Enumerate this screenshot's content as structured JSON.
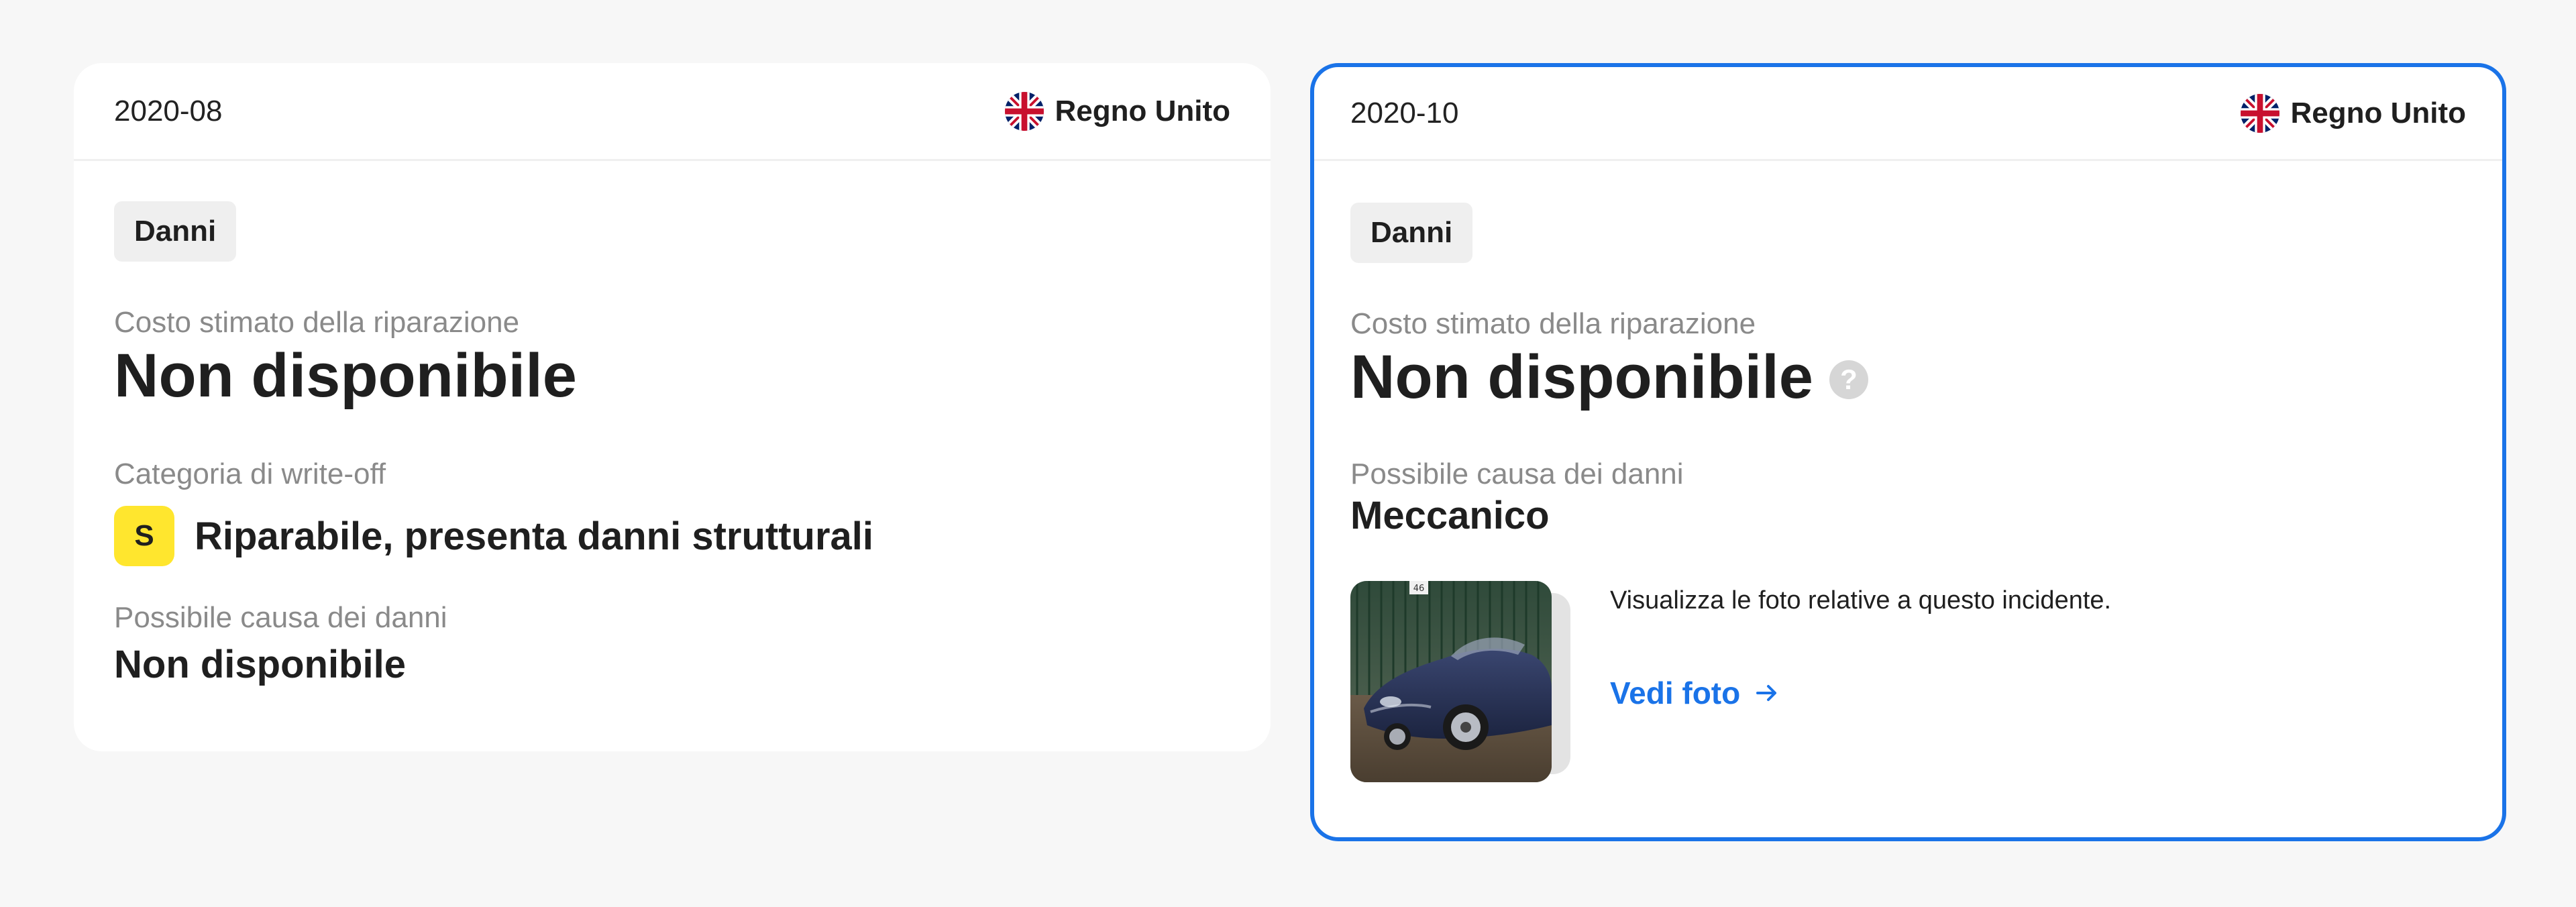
{
  "cards": [
    {
      "date": "2020-08",
      "country": "Regno Unito",
      "tag": "Danni",
      "cost_label": "Costo stimato della riparazione",
      "cost_value": "Non disponibile",
      "writeoff_label": "Categoria di write-off",
      "writeoff_badge": "S",
      "writeoff_text": "Riparabile, presenta danni strutturali",
      "cause_label": "Possibile causa dei danni",
      "cause_value": "Non disponibile"
    },
    {
      "date": "2020-10",
      "country": "Regno Unito",
      "tag": "Danni",
      "cost_label": "Costo stimato della riparazione",
      "cost_value": "Non disponibile",
      "help_icon": "?",
      "cause_label": "Possibile causa dei danni",
      "cause_value": "Meccanico",
      "photo_description": "Visualizza le foto relative a questo incidente.",
      "photo_link": "Vedi foto",
      "photo_badge": "46"
    }
  ],
  "colors": {
    "accent": "#1a73e8",
    "writeoff_badge": "#ffe62e",
    "tag_bg": "#efefef",
    "muted_text": "#8a8a8a"
  },
  "icons": {
    "flag": "uk-flag-icon",
    "help": "question-mark-icon",
    "arrow": "arrow-right-icon"
  }
}
